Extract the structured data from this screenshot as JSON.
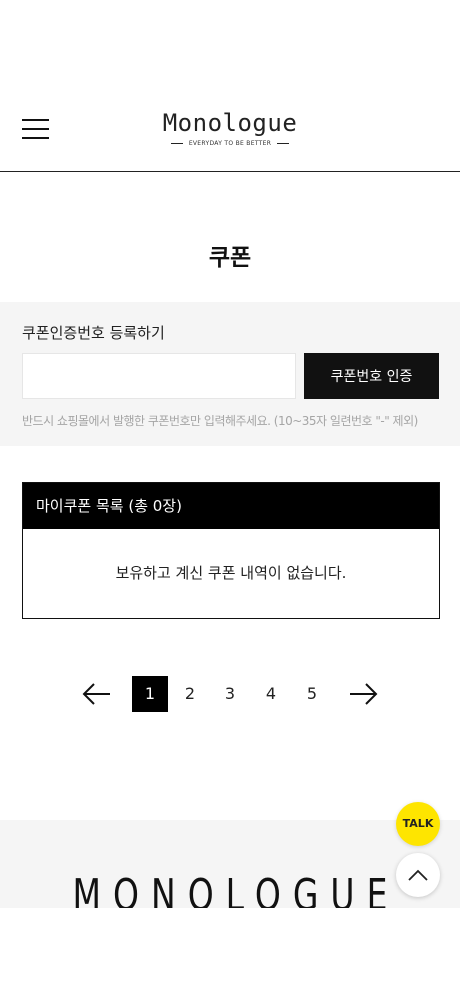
{
  "header": {
    "logo_title": "Monologue",
    "logo_tagline": "EVERYDAY TO BE BETTER",
    "menu_icon": "hamburger-icon"
  },
  "page": {
    "title": "쿠폰"
  },
  "coupon_register": {
    "label": "쿠폰인증번호 등록하기",
    "input_value": "",
    "input_placeholder": "",
    "submit_label": "쿠폰번호 인증",
    "hint": "반드시 쇼핑몰에서 발행한 쿠폰번호만 입력해주세요. (10~35자 일련번호 \"-\" 제외)"
  },
  "my_coupons": {
    "header": "마이쿠폰 목록 (총 0장)",
    "empty_message": "보유하고 계신 쿠폰 내역이 없습니다."
  },
  "pagination": {
    "prev_icon": "arrow-left-icon",
    "next_icon": "arrow-right-icon",
    "current": 1,
    "pages": [
      "1",
      "2",
      "3",
      "4",
      "5"
    ]
  },
  "footer": {
    "logo_text": "MONOLOGUE"
  },
  "floating": {
    "talk_label": "TALK",
    "talk_color": "#fee500",
    "top_icon": "chevron-up-icon"
  }
}
